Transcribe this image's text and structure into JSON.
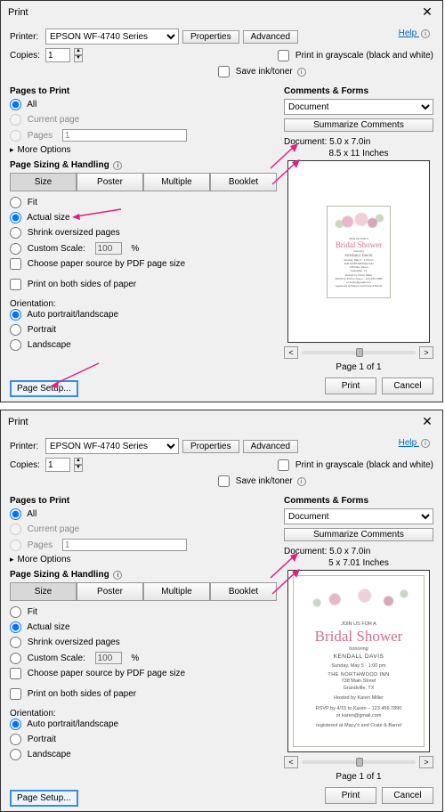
{
  "dialog1": {
    "title": "Print",
    "printer_label": "Printer:",
    "printer_value": "EPSON WF-4740 Series",
    "properties_btn": "Properties",
    "advanced_btn": "Advanced",
    "help_link": "Help",
    "copies_label": "Copies:",
    "copies_value": "1",
    "grayscale_label": "Print in grayscale (black and white)",
    "saveink_label": "Save ink/toner",
    "pages_to_print": "Pages to Print",
    "opt_all": "All",
    "opt_current": "Current page",
    "opt_pages": "Pages",
    "pages_value": "1",
    "more_options": "More Options",
    "sizing_title": "Page Sizing & Handling",
    "tab_size": "Size",
    "tab_poster": "Poster",
    "tab_multiple": "Multiple",
    "tab_booklet": "Booklet",
    "opt_fit": "Fit",
    "opt_actual": "Actual size",
    "opt_shrink": "Shrink oversized pages",
    "opt_custom": "Custom Scale:",
    "custom_value": "100",
    "percent": "%",
    "choose_paper": "Choose paper source by PDF page size",
    "print_both": "Print on both sides of paper",
    "orientation": "Orientation:",
    "ori_auto": "Auto portrait/landscape",
    "ori_portrait": "Portrait",
    "ori_landscape": "Landscape",
    "comments_forms": "Comments & Forms",
    "cf_value": "Document",
    "summarize_btn": "Summarize Comments",
    "doc_dims": "Document: 5.0 x 7.0in",
    "inches": "8.5 x 11 Inches",
    "inv_join": "JOIN US FOR A",
    "inv_title": "Bridal Shower",
    "inv_honor": "honoring",
    "inv_name": "KENDALL DAVIS",
    "inv_date": "Sunday, May 5 · 1:00 pm",
    "inv_venue": "THE NORTHWOOD INN",
    "inv_addr1": "738 Main Street",
    "inv_addr2": "Grandville, TX",
    "inv_host": "Hosted by Karen Miller",
    "inv_rsvp1": "RSVP by 4/15 to Karen – 123.456.7890",
    "inv_rsvp2": "or karen@gmail.com",
    "inv_reg": "registered at Macy's and Crate & Barrel",
    "page_of": "Page 1 of 1",
    "page_setup": "Page Setup...",
    "print_btn": "Print",
    "cancel_btn": "Cancel"
  },
  "dialog2": {
    "title": "Print",
    "printer_label": "Printer:",
    "printer_value": "EPSON WF-4740 Series",
    "properties_btn": "Properties",
    "advanced_btn": "Advanced",
    "help_link": "Help",
    "copies_label": "Copies:",
    "copies_value": "1",
    "grayscale_label": "Print in grayscale (black and white)",
    "saveink_label": "Save ink/toner",
    "pages_to_print": "Pages to Print",
    "opt_all": "All",
    "opt_current": "Current page",
    "opt_pages": "Pages",
    "pages_value": "1",
    "more_options": "More Options",
    "sizing_title": "Page Sizing & Handling",
    "tab_size": "Size",
    "tab_poster": "Poster",
    "tab_multiple": "Multiple",
    "tab_booklet": "Booklet",
    "opt_fit": "Fit",
    "opt_actual": "Actual size",
    "opt_shrink": "Shrink oversized pages",
    "opt_custom": "Custom Scale:",
    "custom_value": "100",
    "percent": "%",
    "choose_paper": "Choose paper source by PDF page size",
    "print_both": "Print on both sides of paper",
    "orientation": "Orientation:",
    "ori_auto": "Auto portrait/landscape",
    "ori_portrait": "Portrait",
    "ori_landscape": "Landscape",
    "comments_forms": "Comments & Forms",
    "cf_value": "Document",
    "summarize_btn": "Summarize Comments",
    "doc_dims": "Document: 5.0 x 7.0in",
    "inches": "5 x 7.01 Inches",
    "inv_join": "JOIN US FOR A",
    "inv_title": "Bridal Shower",
    "inv_honor": "honoring",
    "inv_name": "KENDALL DAVIS",
    "inv_date": "Sunday, May 5 · 1:00 pm",
    "inv_venue": "THE NORTHWOOD INN",
    "inv_addr1": "738 Main Street",
    "inv_addr2": "Grandville, TX",
    "inv_host": "Hosted by Karen Miller",
    "inv_rsvp1": "RSVP by 4/15 to Karen – 123.456.7890",
    "inv_rsvp2": "or karen@gmail.com",
    "inv_reg": "registered at Macy's and Crate & Barrel",
    "page_of": "Page 1 of 1",
    "page_setup": "Page Setup...",
    "print_btn": "Print",
    "cancel_btn": "Cancel"
  }
}
